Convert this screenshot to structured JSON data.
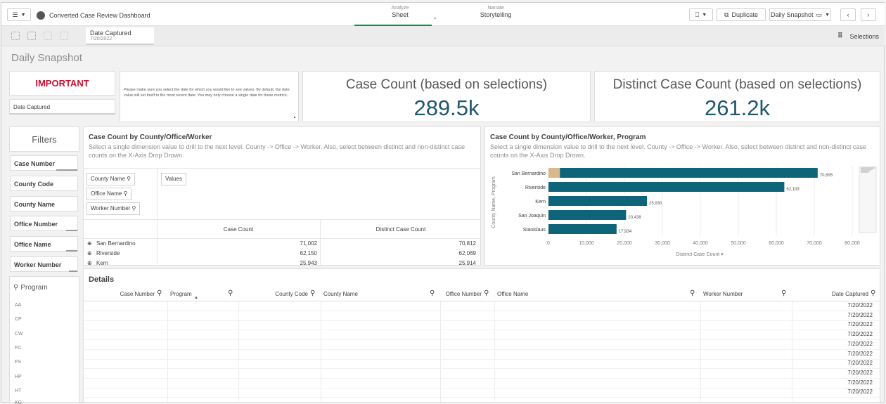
{
  "app": {
    "title": "Converted Case Review Dashboard"
  },
  "nav": {
    "analyze": {
      "small": "Analyze",
      "label": "Sheet"
    },
    "narrate": {
      "small": "Narrate",
      "label": "Storytelling"
    }
  },
  "toolbar": {
    "duplicate_label": "Duplicate",
    "sheet_name": "Daily Snapshot"
  },
  "selection_bar": {
    "chip_title": "Date Captured",
    "chip_value": "7/20/2022",
    "selections_label": "Selections"
  },
  "sheet": {
    "title": "Daily Snapshot"
  },
  "important": {
    "title": "IMPORTANT",
    "field": "Date Captured"
  },
  "note": {
    "text": "Please make sure you select the date for which you would like to see values. By default, the date value will set itself to the most recent date. You may only choose a single date for these metrics."
  },
  "kpi1": {
    "title": "Case Count (based on selections)",
    "value": "289.5k"
  },
  "kpi2": {
    "title": "Distinct Case Count (based on selections)",
    "value": "261.2k"
  },
  "filters": {
    "title": "Filters",
    "items": [
      "Case Number",
      "County Code",
      "County Name",
      "Office Number",
      "Office Name",
      "Worker Number"
    ],
    "program_search": "Program",
    "programs": [
      "AA",
      "CP",
      "CW",
      "FC",
      "FS",
      "HP",
      "HT",
      "KG"
    ]
  },
  "pivot": {
    "title": "Case Count by County/Office/Worker",
    "subtitle": "Select a single dimension value to drill to the next level. County -> Office -> Worker. Also, select between distinct and non-distinct case counts on the X-Axis Drop Drown.",
    "dims": [
      "County Name",
      "Office Name",
      "Worker Number"
    ],
    "values_label": "Values",
    "col_headers": [
      "Case Count",
      "Distinct Case Count"
    ],
    "rows": [
      {
        "name": "San Bernardino",
        "case": "71,002",
        "distinct": "70,812"
      },
      {
        "name": "Riverside",
        "case": "62,150",
        "distinct": "62,069"
      },
      {
        "name": "Kern",
        "case": "25,943",
        "distinct": "25,914"
      }
    ]
  },
  "barchart": {
    "title": "Case Count by County/Office/Worker, Program",
    "subtitle": "Select a single dimension value to drill to the next level. County -> Office -> Worker. Also, select between distinct and non-distinct case counts on the X-Axis Drop Drown.",
    "ylabel": "County Name, Program",
    "xlabel": "Distinct Case Count"
  },
  "chart_data": {
    "type": "bar",
    "orientation": "horizontal",
    "title": "Case Count by County/Office/Worker, Program",
    "xlabel": "Distinct Case Count",
    "ylabel": "County Name, Program",
    "categories": [
      "San Bernardino",
      "Riverside",
      "Kern",
      "San Joaquin",
      "Stanislaus"
    ],
    "series": [
      {
        "values": [
          3000,
          0,
          0,
          0,
          0
        ]
      },
      {
        "values": [
          67895,
          62109,
          25930,
          20438,
          17934
        ]
      }
    ],
    "data_labels": [
      "70,895",
      "62,109",
      "25,930",
      "20,438",
      "17,934"
    ],
    "xlim": [
      0,
      80000
    ],
    "xticks": [
      "0",
      "10,000",
      "20,000",
      "30,000",
      "40,000",
      "50,000",
      "60,000",
      "70,000",
      "80,000"
    ],
    "grid": true,
    "colors": {
      "primary": "#0e6478",
      "secondary": "#d9b88c"
    }
  },
  "details": {
    "title": "Details",
    "columns": [
      "Case Number",
      "Program",
      "County Code",
      "County Name",
      "Office Number",
      "Office Name",
      "Worker Number",
      "Date Captured"
    ],
    "dates": [
      "7/20/2022",
      "7/20/2022",
      "7/20/2022",
      "7/20/2022",
      "7/20/2022",
      "7/20/2022",
      "7/20/2022",
      "7/20/2022",
      "7/20/2022",
      "7/20/2022"
    ]
  }
}
